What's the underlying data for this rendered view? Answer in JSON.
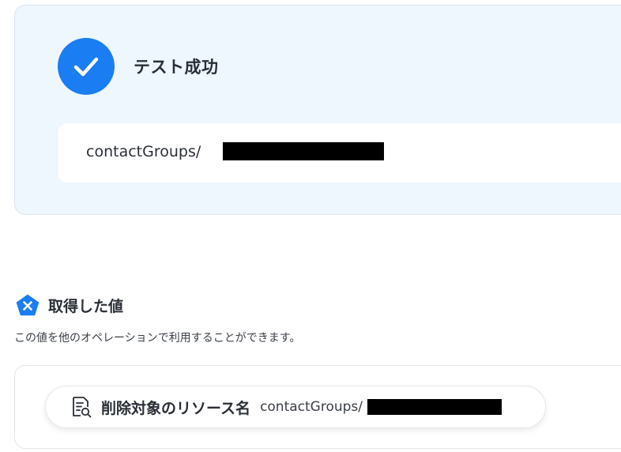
{
  "test_result": {
    "status_icon": "check-circle-icon",
    "title": "テスト成功",
    "output_prefix": "contactGroups/",
    "output_redacted": true
  },
  "fetched_values": {
    "icon": "pentagon-x-icon",
    "title": "取得した値",
    "description": "この値を他のオペレーションで利用することができます。",
    "items": [
      {
        "icon": "document-search-icon",
        "label": "削除対象のリソース名",
        "value_prefix": "contactGroups/",
        "value_redacted": true
      }
    ]
  },
  "colors": {
    "accent": "#1a7df1",
    "card_background": "#eef6fe"
  }
}
